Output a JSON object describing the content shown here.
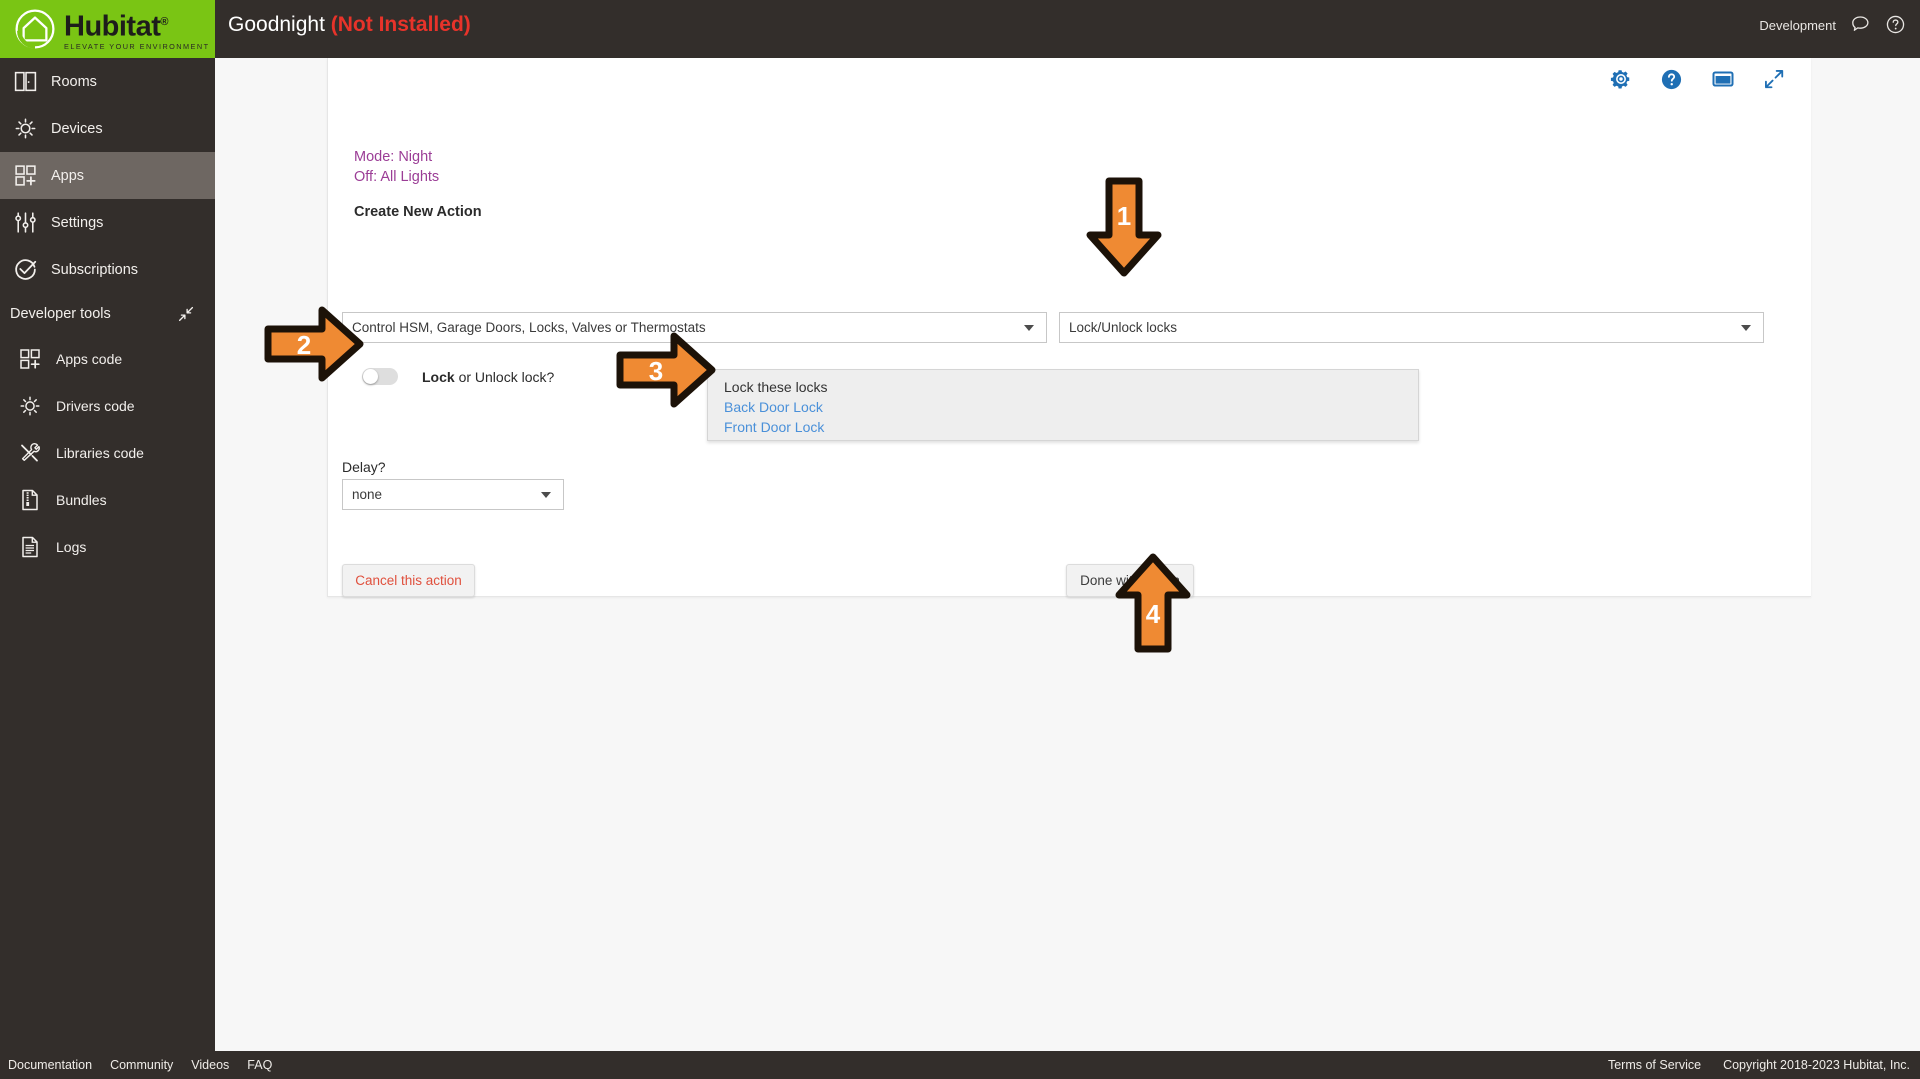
{
  "brand": {
    "name": "Hubitat",
    "trademark": "®",
    "tagline": "ELEVATE YOUR ENVIRONMENT",
    "logo_icon": "hubitat-house-icon",
    "green": "#7ac514"
  },
  "header": {
    "app_name": "Goodnight",
    "status": "(Not Installed)",
    "status_color": "#e8332a",
    "environment": "Development",
    "chat_icon": "chat-bubble-icon",
    "help_icon": "question-circle-icon"
  },
  "sidebar": {
    "items": [
      {
        "label": "Rooms",
        "icon": "rooms-icon",
        "active": false
      },
      {
        "label": "Devices",
        "icon": "device-bulb-icon",
        "active": false
      },
      {
        "label": "Apps",
        "icon": "apps-grid-plus-icon",
        "active": true
      },
      {
        "label": "Settings",
        "icon": "sliders-icon",
        "active": false
      },
      {
        "label": "Subscriptions",
        "icon": "check-circle-icon",
        "active": false
      }
    ],
    "developer_tools": {
      "label": "Developer tools",
      "collapse_icon": "collapse-arrows-icon",
      "items": [
        {
          "label": "Apps code",
          "icon": "apps-grid-plus-icon"
        },
        {
          "label": "Drivers code",
          "icon": "device-bulb-icon"
        },
        {
          "label": "Libraries code",
          "icon": "tools-wrench-screwdriver-icon"
        },
        {
          "label": "Bundles",
          "icon": "bundle-zip-file-icon"
        },
        {
          "label": "Logs",
          "icon": "document-lines-icon"
        }
      ]
    }
  },
  "card": {
    "icons": [
      {
        "name": "gear-icon",
        "color": "#1f6fb4"
      },
      {
        "name": "question-circle-icon",
        "color": "#1f6fb4"
      },
      {
        "name": "monitor-window-icon",
        "color": "#1f6fb4"
      },
      {
        "name": "expand-diagonal-icon",
        "color": "#1f6fb4"
      }
    ],
    "mode_line": "Mode: Night",
    "off_line": "Off: All Lights",
    "mode_color": "#9b3d96",
    "section_title": "Create New Action",
    "action_type_select": {
      "value": "Control HSM, Garage Doors, Locks, Valves or Thermostats",
      "caret_icon": "chevron-down-icon"
    },
    "capability_select": {
      "value": "Lock/Unlock locks",
      "caret_icon": "chevron-down-icon"
    },
    "lock_toggle": {
      "state": "off",
      "label_bold": "Lock",
      "label_rest": " or Unlock lock?"
    },
    "locks_panel": {
      "title": "Lock these locks",
      "locks": [
        "Back Door Lock",
        "Front Door Lock"
      ],
      "link_color": "#4a90d9"
    },
    "delay": {
      "label": "Delay?",
      "value": "none",
      "caret_icon": "chevron-down-icon"
    },
    "cancel_button": "Cancel this action",
    "done_button": "Done with action"
  },
  "annotations": [
    {
      "id": "1",
      "number": "1",
      "direction": "down",
      "color": "#ef8a33"
    },
    {
      "id": "2",
      "number": "2",
      "direction": "right",
      "color": "#ef8a33"
    },
    {
      "id": "3",
      "number": "3",
      "direction": "right",
      "color": "#ef8a33"
    },
    {
      "id": "4",
      "number": "4",
      "direction": "up",
      "color": "#ef8a33"
    }
  ],
  "footer": {
    "left_links": [
      "Documentation",
      "Community",
      "Videos",
      "FAQ"
    ],
    "right_links": [
      "Terms of Service",
      "Copyright 2018-2023 Hubitat, Inc."
    ]
  }
}
